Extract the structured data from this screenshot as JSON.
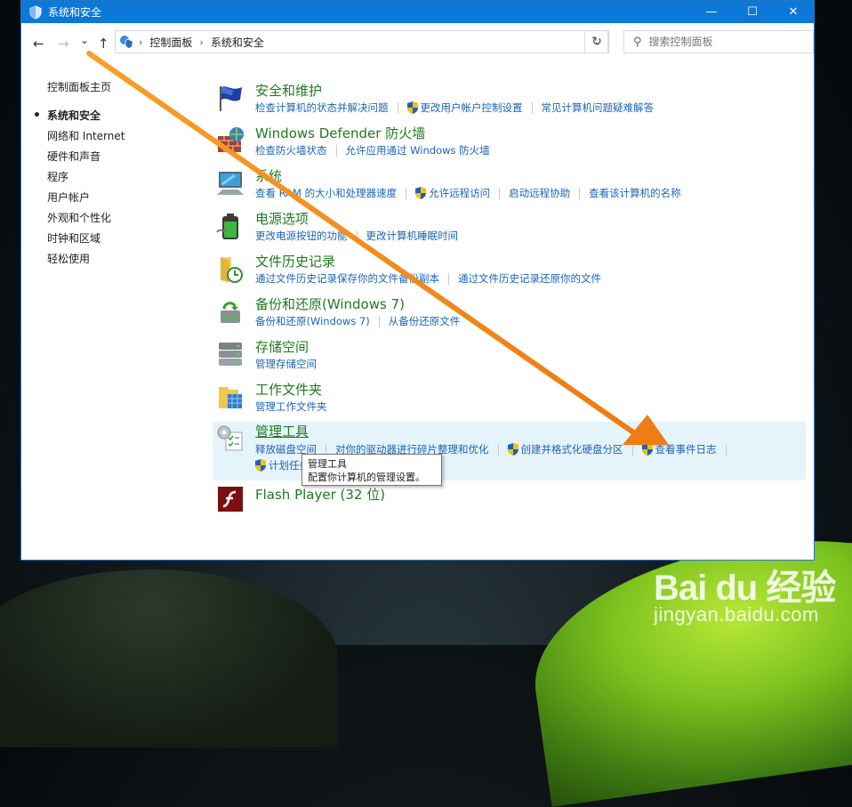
{
  "window": {
    "title": "系统和安全",
    "controls": {
      "minimize": "—",
      "maximize": "☐",
      "close": "✕"
    }
  },
  "navbar": {
    "back": "←",
    "forward": "→",
    "recent": "⌄",
    "up": "↑",
    "breadcrumb": [
      "控制面板",
      "系统和安全"
    ],
    "refresh": "↻",
    "search_placeholder": "搜索控制面板"
  },
  "sidebar": {
    "home": "控制面板主页",
    "items": [
      {
        "label": "系统和安全",
        "active": true
      },
      {
        "label": "网络和 Internet",
        "active": false
      },
      {
        "label": "硬件和声音",
        "active": false
      },
      {
        "label": "程序",
        "active": false
      },
      {
        "label": "用户帐户",
        "active": false
      },
      {
        "label": "外观和个性化",
        "active": false
      },
      {
        "label": "时钟和区域",
        "active": false
      },
      {
        "label": "轻松使用",
        "active": false
      }
    ]
  },
  "categories": [
    {
      "title": "安全和维护",
      "icon": "flag-icon",
      "links": [
        "检查计算机的状态并解决问题",
        "更改用户帐户控制设置",
        "常见计算机问题疑难解答"
      ]
    },
    {
      "title": "Windows Defender 防火墙",
      "icon": "firewall-icon",
      "links": [
        "检查防火墙状态",
        "允许应用通过 Windows 防火墙"
      ]
    },
    {
      "title": "系统",
      "icon": "computer-icon",
      "links": [
        "查看 RAM 的大小和处理器速度",
        "允许远程访问",
        "启动远程协助",
        "查看该计算机的名称"
      ]
    },
    {
      "title": "电源选项",
      "icon": "battery-icon",
      "links": [
        "更改电源按钮的功能",
        "更改计算机睡眠时间"
      ]
    },
    {
      "title": "文件历史记录",
      "icon": "file-history-icon",
      "links": [
        "通过文件历史记录保存你的文件备份副本",
        "通过文件历史记录还原你的文件"
      ]
    },
    {
      "title": "备份和还原(Windows 7)",
      "icon": "backup-icon",
      "links": [
        "备份和还原(Windows 7)",
        "从备份还原文件"
      ]
    },
    {
      "title": "存储空间",
      "icon": "storage-icon",
      "links": [
        "管理存储空间"
      ]
    },
    {
      "title": "工作文件夹",
      "icon": "work-folders-icon",
      "links": [
        "管理工作文件夹"
      ]
    },
    {
      "title": "管理工具",
      "icon": "admin-tools-icon",
      "links": [
        "释放磁盘空间",
        "对你的驱动器进行碎片整理和优化",
        "创建并格式化硬盘分区",
        "查看事件日志",
        "计划任务"
      ]
    },
    {
      "title": "Flash Player (32 位)",
      "icon": "flash-icon",
      "links": []
    }
  ],
  "tooltip": {
    "title": "管理工具",
    "description": "配置你计算机的管理设置。"
  },
  "watermark": {
    "brand": "Bai du 经验",
    "url": "jingyan.baidu.com"
  },
  "colors": {
    "accent": "#0c78d8",
    "title_green": "#1f7a1f",
    "link_blue": "#1a64b8",
    "annotation_arrow": "#f08a1c"
  }
}
